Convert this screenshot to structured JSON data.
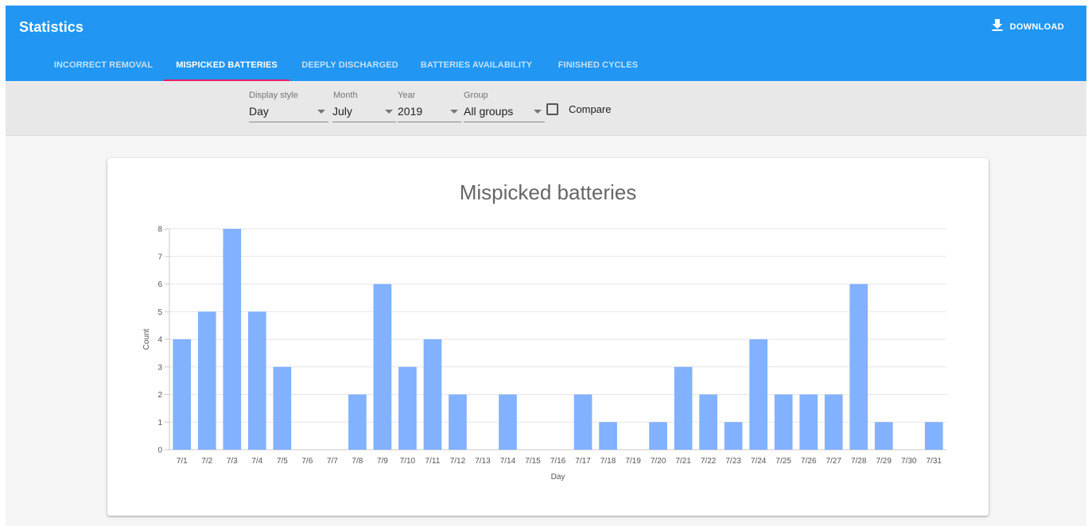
{
  "app": {
    "title": "Statistics",
    "download_label": "DOWNLOAD"
  },
  "tabs": [
    {
      "label": "INCORRECT REMOVAL",
      "active": false
    },
    {
      "label": "MISPICKED BATTERIES",
      "active": true
    },
    {
      "label": "DEEPLY DISCHARGED",
      "active": false
    },
    {
      "label": "BATTERIES AVAILABILITY",
      "active": false
    },
    {
      "label": "FINISHED CYCLES",
      "active": false
    }
  ],
  "filters": {
    "display_style": {
      "label": "Display style",
      "value": "Day"
    },
    "month": {
      "label": "Month",
      "value": "July"
    },
    "year": {
      "label": "Year",
      "value": "2019"
    },
    "group": {
      "label": "Group",
      "value": "All groups"
    },
    "compare": {
      "label": "Compare",
      "checked": false
    }
  },
  "colors": {
    "appbar": "#2196f3",
    "tab_indicator": "#e91e63",
    "bar": "#82b1ff"
  },
  "chart_data": {
    "type": "bar",
    "title": "Mispicked batteries",
    "xlabel": "Day",
    "ylabel": "Count",
    "ylim": [
      0,
      8
    ],
    "yticks": [
      0,
      1,
      2,
      3,
      4,
      5,
      6,
      7,
      8
    ],
    "grid": true,
    "categories": [
      "7/1",
      "7/2",
      "7/3",
      "7/4",
      "7/5",
      "7/6",
      "7/7",
      "7/8",
      "7/9",
      "7/10",
      "7/11",
      "7/12",
      "7/13",
      "7/14",
      "7/15",
      "7/16",
      "7/17",
      "7/18",
      "7/19",
      "7/20",
      "7/21",
      "7/22",
      "7/23",
      "7/24",
      "7/25",
      "7/26",
      "7/27",
      "7/28",
      "7/29",
      "7/30",
      "7/31"
    ],
    "values": [
      4,
      5,
      8,
      5,
      3,
      0,
      0,
      2,
      6,
      3,
      4,
      2,
      0,
      2,
      0,
      0,
      2,
      1,
      0,
      1,
      3,
      2,
      1,
      4,
      2,
      2,
      2,
      6,
      1,
      0,
      1
    ]
  }
}
